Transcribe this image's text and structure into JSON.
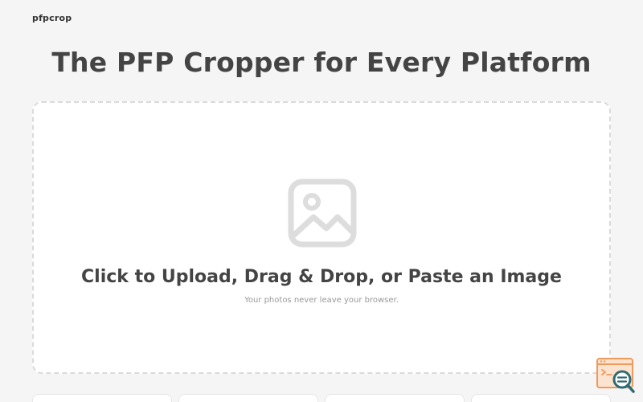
{
  "header": {
    "logo_text": "pfpcrop"
  },
  "hero": {
    "title": "The PFP Cropper for Every Platform"
  },
  "dropzone": {
    "icon": "image-icon",
    "title": "Click to Upload, Drag & Drop, or Paste an Image",
    "subtitle": "Your photos never leave your browser."
  },
  "floating_widget": {
    "icon": "search-bug-icon",
    "accent_color": "#f0a060"
  },
  "colors": {
    "background": "#f5f5f5",
    "text": "#444444",
    "muted": "#999999",
    "dashed_border": "#dadada"
  }
}
